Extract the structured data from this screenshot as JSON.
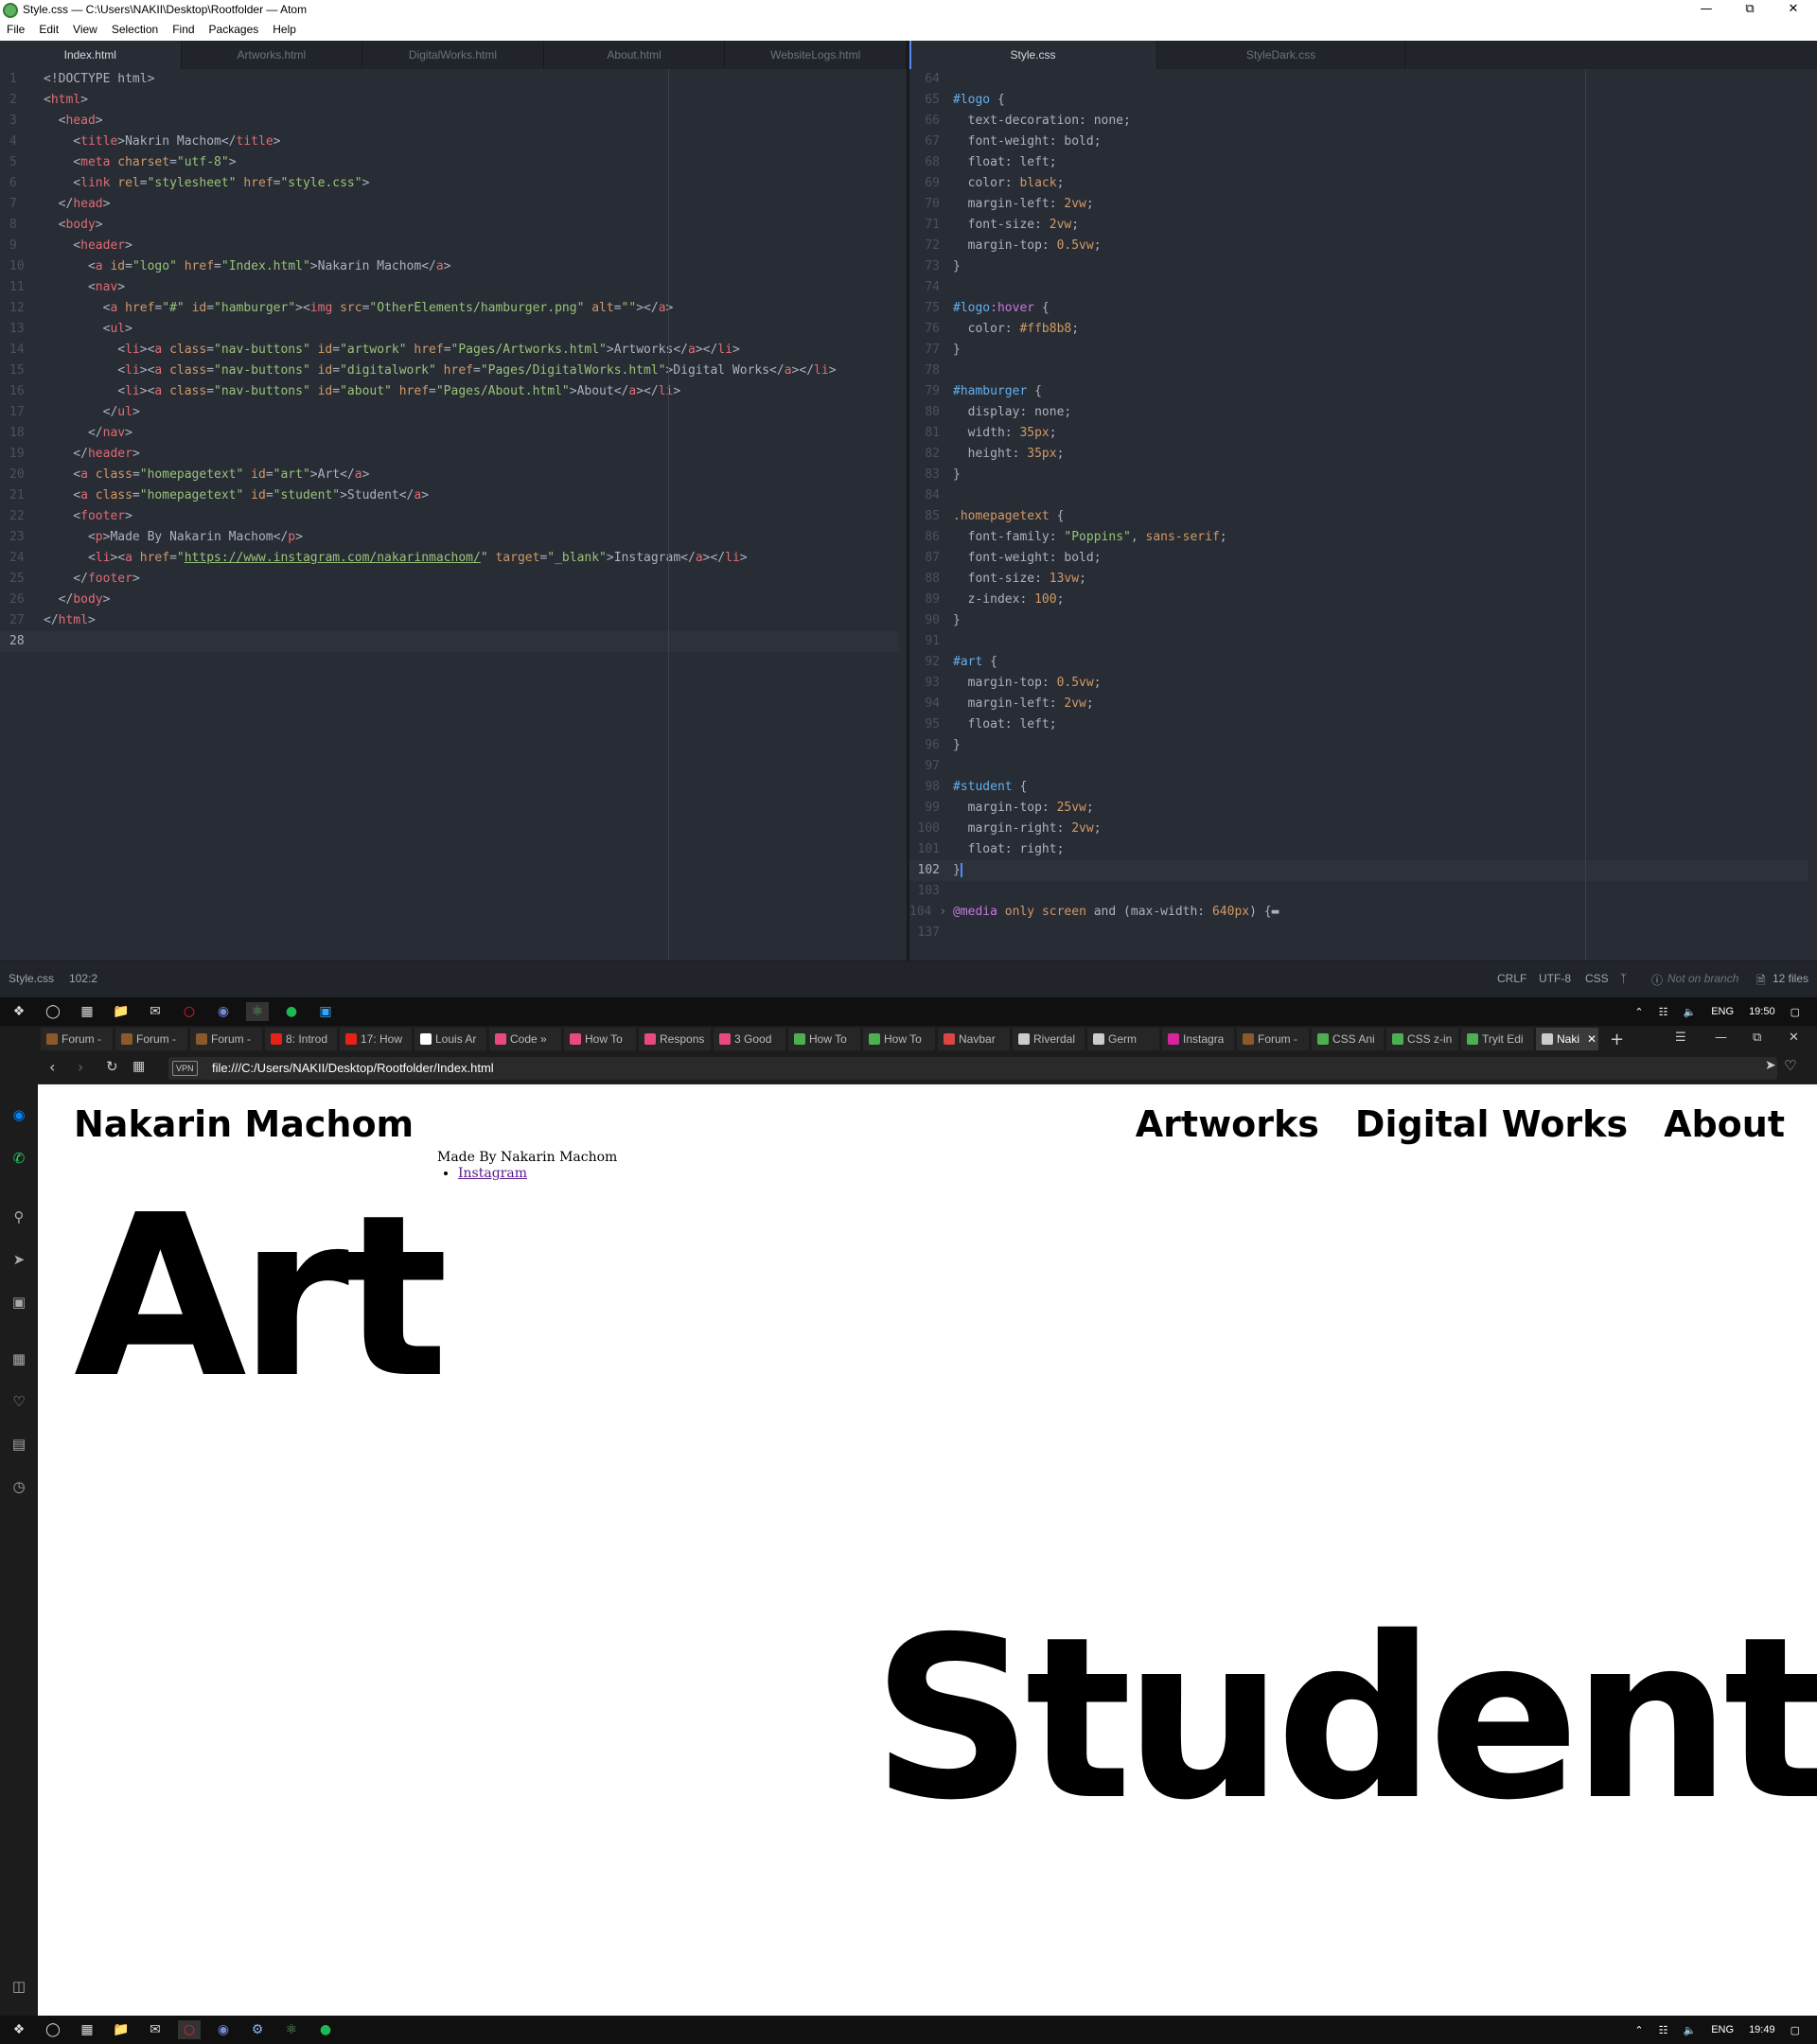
{
  "atom": {
    "title": "Style.css — C:\\Users\\NAKII\\Desktop\\Rootfolder — Atom",
    "menu": [
      "File",
      "Edit",
      "View",
      "Selection",
      "Find",
      "Packages",
      "Help"
    ],
    "left_tabs": [
      "Index.html",
      "Artworks.html",
      "DigitalWorks.html",
      "About.html",
      "WebsiteLogs.html"
    ],
    "right_tabs": [
      "Style.css",
      "StyleDark.css"
    ],
    "status": {
      "file": "Style.css",
      "cursor": "102:2",
      "line_ending": "CRLF",
      "encoding": "UTF-8",
      "grammar": "CSS",
      "git": "Not on branch",
      "files": "12 files"
    }
  },
  "taskbar_top": {
    "lang": "ENG",
    "time": "19:50"
  },
  "taskbar_bottom": {
    "lang": "ENG",
    "time": "19:49"
  },
  "browser": {
    "tabs": [
      "Forum -",
      "Forum -",
      "Forum -",
      "8: Introd",
      "17: How",
      "Louis Ar",
      "Code »",
      "How To",
      "Respons",
      "3 Good",
      "How To",
      "How To",
      "Navbar",
      "Riverdal",
      "Germ",
      "Instagra",
      "Forum -",
      "CSS Ani",
      "CSS z-in",
      "Tryit Edi",
      "Naki"
    ],
    "tab_colors": [
      "#8a5a2b",
      "#8a5a2b",
      "#8a5a2b",
      "#e62117",
      "#e62117",
      "#ffffff",
      "#e84a7f",
      "#e84a7f",
      "#e84a7f",
      "#e84a7f",
      "#4caf50",
      "#4caf50",
      "#d44",
      "#cccccc",
      "#cccccc",
      "#d6249f",
      "#8a5a2b",
      "#4caf50",
      "#4caf50",
      "#4caf50",
      "#cccccc"
    ],
    "vpn": "VPN",
    "url": "file:///C:/Users/NAKII/Desktop/Rootfolder/Index.html"
  },
  "webpage": {
    "logo": "Nakarin Machom",
    "nav": [
      "Artworks",
      "Digital Works",
      "About"
    ],
    "footer_text": "Made By Nakarin Machom",
    "footer_link": "Instagram",
    "art": "Art",
    "student": "Student"
  }
}
